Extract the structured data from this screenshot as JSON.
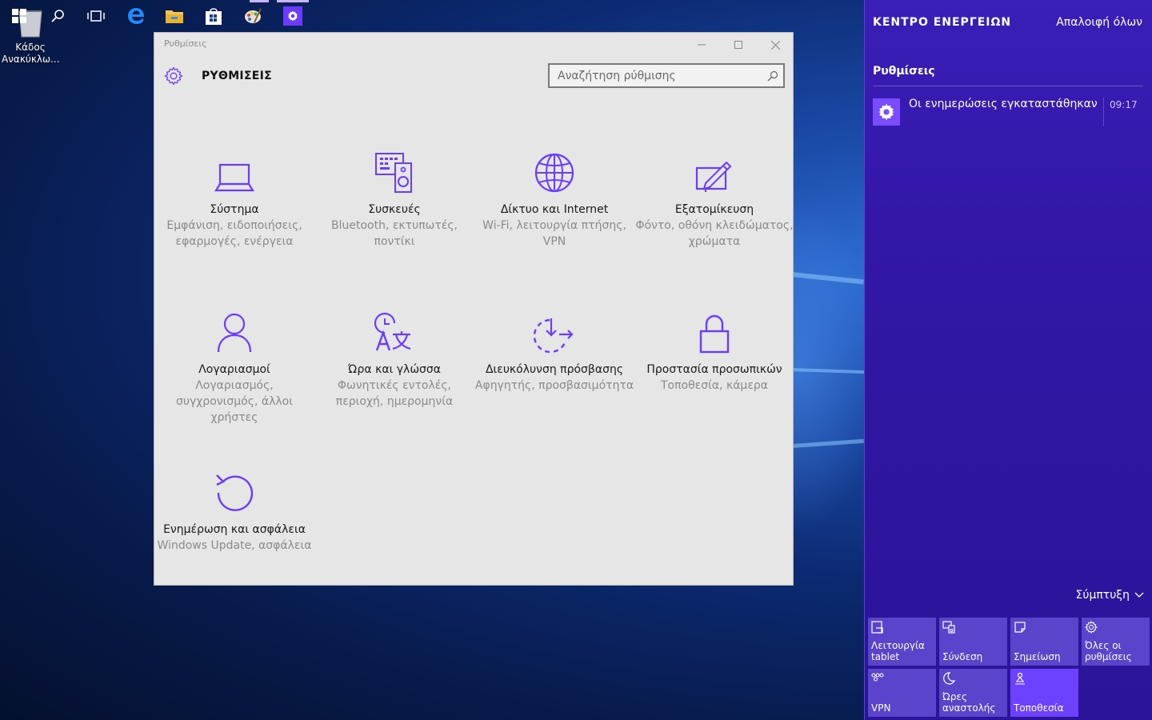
{
  "desktop": {
    "recycle_bin_label": "Κάδος Ανακύκλω..."
  },
  "taskbar": {
    "icons": [
      "windows-start-icon",
      "search-icon",
      "task-view-icon",
      "edge-icon",
      "file-explorer-icon",
      "store-icon",
      "paint-icon",
      "settings-icon"
    ]
  },
  "window": {
    "title": "Ρυθμίσεις",
    "header": "ΡΥΘΜΙΣΕΙΣ",
    "search_placeholder": "Αναζήτηση ρύθμισης",
    "tiles": [
      {
        "name": "Σύστημα",
        "desc": "Εμφάνιση, ειδοποιήσεις, εφαρμογές, ενέργεια",
        "icon": "laptop-icon"
      },
      {
        "name": "Συσκευές",
        "desc": "Bluetooth, εκτυπωτές, ποντίκι",
        "icon": "devices-icon"
      },
      {
        "name": "Δίκτυο και Internet",
        "desc": "Wi-Fi, λειτουργία πτήσης, VPN",
        "icon": "globe-icon"
      },
      {
        "name": "Εξατομίκευση",
        "desc": "Φόντο, οθόνη κλειδώματος, χρώματα",
        "icon": "personalization-icon"
      },
      {
        "name": "Λογαριασμοί",
        "desc": "Λογαριασμός, συγχρονισμός, άλλοι χρήστες",
        "icon": "person-icon"
      },
      {
        "name": "Ώρα και γλώσσα",
        "desc": "Φωνητικές εντολές, περιοχή, ημερομηνία",
        "icon": "time-language-icon"
      },
      {
        "name": "Διευκόλυνση πρόσβασης",
        "desc": "Αφηγητής, προσβασιμότητα",
        "icon": "ease-of-access-icon"
      },
      {
        "name": "Προστασία προσωπικών",
        "desc": "Τοποθεσία, κάμερα",
        "icon": "lock-icon"
      },
      {
        "name": "Ενημέρωση και ασφάλεια",
        "desc": "Windows Update, ασφάλεια",
        "icon": "update-icon"
      }
    ]
  },
  "action_center": {
    "title": "ΚΕΝΤΡΟ ΕΝΕΡΓΕΙΩΝ",
    "clear_all": "Απαλοιφή όλων",
    "group": "Ρυθμίσεις",
    "notification": {
      "text": "Οι ενημερώσεις εγκαταστάθηκαν",
      "time": "09:17"
    },
    "collapse": "Σύμπτυξη",
    "quick_actions": [
      {
        "label": "Λειτουργία tablet",
        "icon": "tablet-mode-icon",
        "on": false
      },
      {
        "label": "Σύνδεση",
        "icon": "connect-icon",
        "on": false
      },
      {
        "label": "Σημείωση",
        "icon": "note-icon",
        "on": false
      },
      {
        "label": "Όλες οι ρυθμίσεις",
        "icon": "settings-gear-icon",
        "on": false
      },
      {
        "label": "VPN",
        "icon": "vpn-icon",
        "on": false
      },
      {
        "label": "Ώρες αναστολής",
        "icon": "moon-icon",
        "on": false
      },
      {
        "label": "Τοποθεσία",
        "icon": "location-icon",
        "on": true
      }
    ]
  },
  "colors": {
    "accent": "#6a3cff",
    "window_bg": "#e6e6e6",
    "action_center_bg": "#3417a8"
  }
}
